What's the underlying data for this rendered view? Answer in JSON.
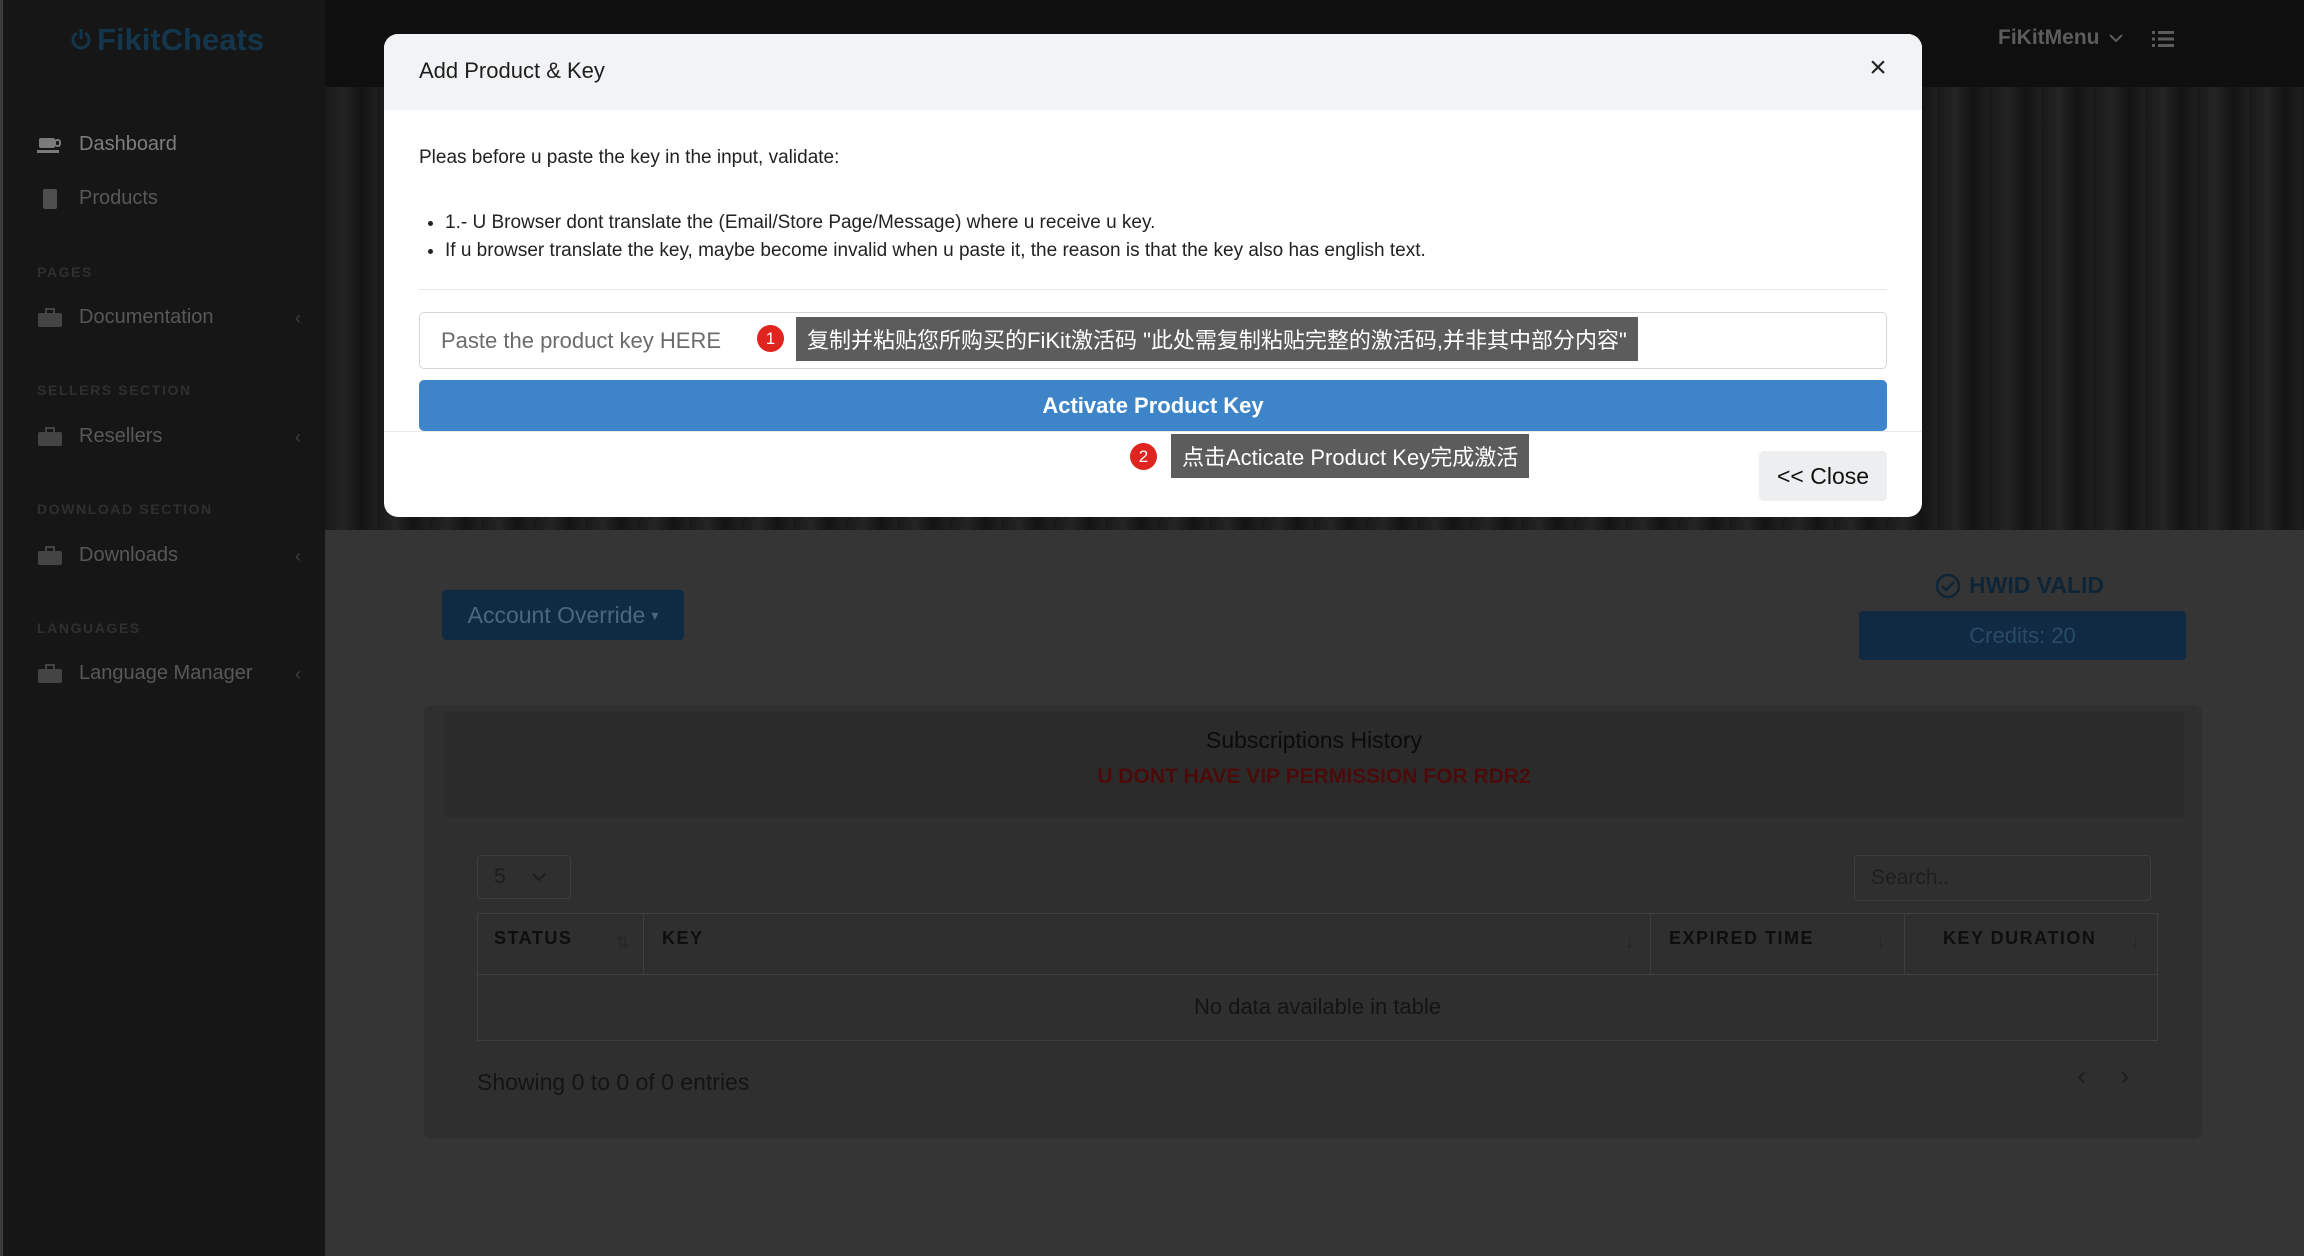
{
  "brand": {
    "name": "FikitCheats"
  },
  "sidebar": {
    "items": [
      {
        "label": "Dashboard"
      },
      {
        "label": "Products"
      }
    ],
    "sections": [
      {
        "title": "PAGES",
        "item": "Documentation"
      },
      {
        "title": "SELLERS SECTION",
        "item": "Resellers"
      },
      {
        "title": "DOWNLOAD SECTION",
        "item": "Downloads"
      },
      {
        "title": "LANGUAGES",
        "item": "Language Manager"
      }
    ]
  },
  "topbar": {
    "menu_label": "FiKitMenu"
  },
  "account": {
    "override_label": "Account Override",
    "hwid_label": "HWID VALID",
    "credits_label": "Credits: 20"
  },
  "subscriptions": {
    "title": "Subscriptions History",
    "warning": "U DONT HAVE VIP PERMISSION FOR RDR2",
    "page_length": "5",
    "search_placeholder": "Search..",
    "columns": [
      "STATUS",
      "KEY",
      "EXPIRED TIME",
      "KEY DURATION"
    ],
    "empty_message": "No data available in table",
    "info": "Showing 0 to 0 of 0 entries"
  },
  "modal": {
    "title": "Add Product & Key",
    "close_glyph": "×",
    "intro": "Pleas before u paste the key in the input, validate:",
    "rules": [
      "1.- U Browser dont translate the (Email/Store Page/Message) where u receive u key.",
      "If u browser translate the key, maybe become invalid when u paste it, the reason is that the key also has english text."
    ],
    "key_placeholder": "Paste the product key HERE",
    "key_value": "",
    "activate_label": "Activate Product Key",
    "close_label": "<< Close"
  },
  "annotations": [
    {
      "number": "1",
      "text": "复制并粘贴您所购买的FiKit激活码 \"此处需复制粘贴完整的激活码,并非其中部分内容\""
    },
    {
      "number": "2",
      "text": "点击Acticate Product Key完成激活"
    }
  ],
  "colors": {
    "primary": "#3d85c8",
    "marker": "#e0241f",
    "callout": "#5c5c5c",
    "overlay": "#353535"
  }
}
